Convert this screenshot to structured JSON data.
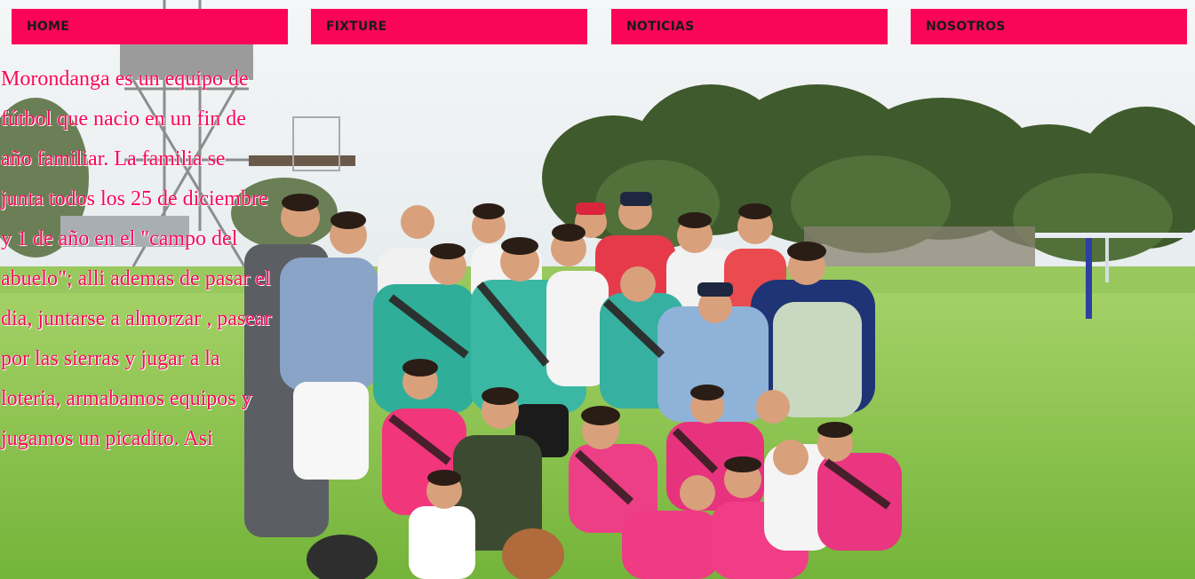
{
  "nav": {
    "items": [
      {
        "label": "HOME"
      },
      {
        "label": "FIXTURE"
      },
      {
        "label": "NOTICIAS"
      },
      {
        "label": "NOSOTROS"
      }
    ]
  },
  "intro": {
    "text": "Morondanga es un equipo de fútbol que nacio en un fin de año familiar. La familia se junta todos los 25 de diciembre y 1 de año en el \"campo del abuelo\"; alli ademas de pasar el dia, juntarse a almorzar , pasear por las sierras y jugar a la loteria, armabamos equipos y jugamos un picadito. Asi"
  },
  "colors": {
    "accent": "#fb0558",
    "nav_text": "#1a1a1a"
  }
}
